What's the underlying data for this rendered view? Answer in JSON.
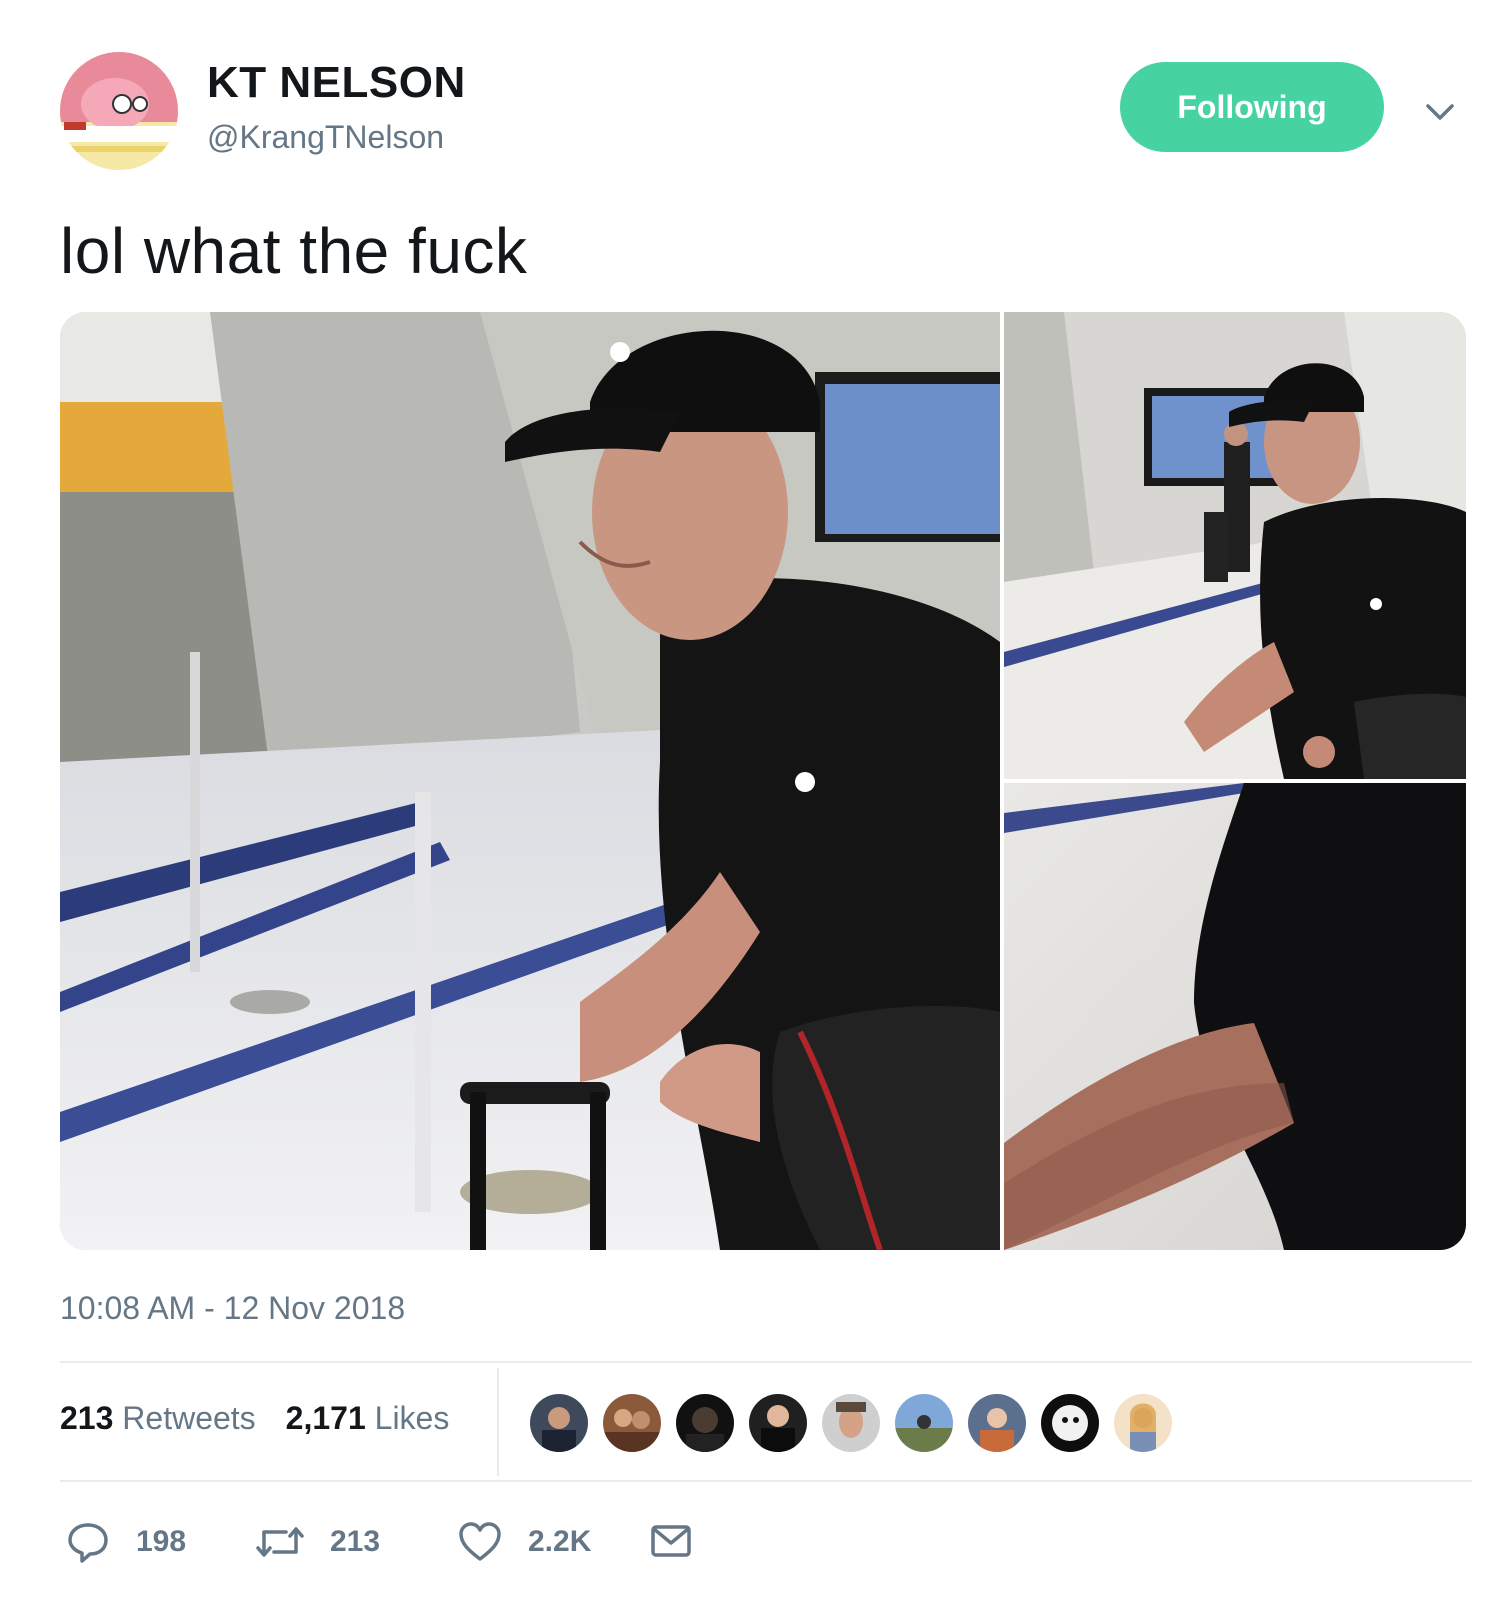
{
  "tweet": {
    "display_name": "KT NELSON",
    "handle": "@KrangTNelson",
    "follow_button_label": "Following",
    "text": "lol what the fuck",
    "timestamp": "10:08 AM - 12 Nov 2018"
  },
  "stats": {
    "retweets_count": "213",
    "retweets_label": "Retweets",
    "likes_count": "2,171",
    "likes_label": "Likes"
  },
  "actions": {
    "reply_count": "198",
    "retweet_count": "213",
    "like_count": "2.2K"
  },
  "icons": {
    "caret": "chevron-down-icon",
    "reply": "reply-icon",
    "retweet": "retweet-icon",
    "like": "heart-icon",
    "dm": "envelope-icon"
  },
  "colors": {
    "follow_button": "#47d3a1",
    "secondary_text": "#657786",
    "primary_text": "#14171a",
    "divider": "#e6ecf0"
  }
}
